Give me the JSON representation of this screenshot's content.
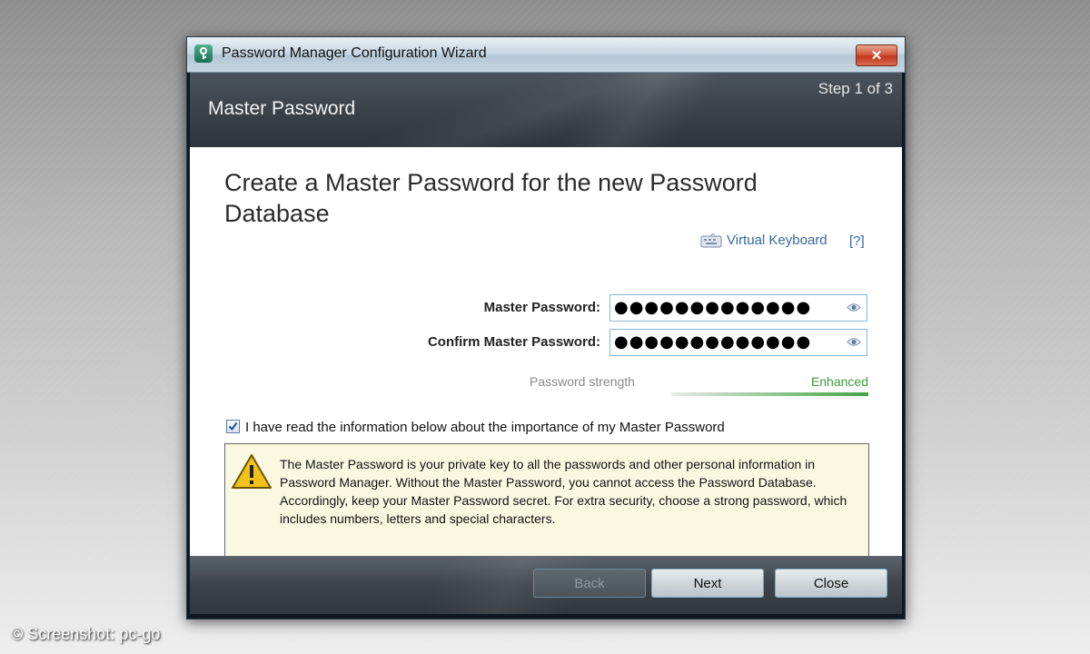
{
  "window": {
    "title": "Password Manager Configuration Wizard",
    "close_label": "✕"
  },
  "header": {
    "title": "Master Password",
    "step": "Step 1 of 3"
  },
  "main": {
    "heading": "Create a Master Password for the new Password Database",
    "virtual_keyboard_label": "Virtual Keyboard",
    "help_label": "[?]",
    "master_password_label": "Master Password:",
    "master_password_value": "●●●●●●●●●●●●●",
    "confirm_password_label": "Confirm Master Password:",
    "confirm_password_value": "●●●●●●●●●●●●●",
    "strength_label": "Password strength",
    "strength_value": "Enhanced",
    "strength_level": 1.0,
    "checkbox_checked": true,
    "checkbox_label": "I have read the information below about the importance of my Master Password",
    "info_text": "The Master Password is your private key to all the passwords and other personal information in Password Manager. Without the Master Password, you cannot access the Password Database. Accordingly, keep your Master Password secret. For extra security, choose a strong password, which includes numbers, letters and special characters."
  },
  "footer": {
    "back_label": "Back",
    "next_label": "Next",
    "close_label": "Close"
  },
  "credit": "© Screenshot: pc-go",
  "colors": {
    "link": "#3667a8",
    "strength": "#3ea43e",
    "info_bg": "#fbf8e2",
    "close_red": "#c0391e"
  },
  "icons": [
    "app-key-icon",
    "close-icon",
    "keyboard-icon",
    "eye-icon",
    "checkmark-icon",
    "warning-icon"
  ]
}
